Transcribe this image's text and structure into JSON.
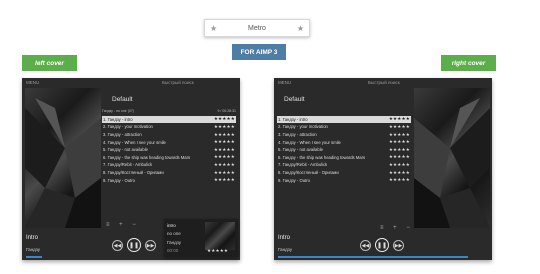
{
  "header": {
    "title": "Metro",
    "left_star": "★",
    "right_star": "★",
    "badge": "FOR AIMP 3"
  },
  "buttons": {
    "left_cover": "left cover",
    "right_cover": "right cover"
  },
  "player": {
    "menu_label": "MENU",
    "search_label": "Быстрый поиск",
    "playlist_name": "Default",
    "playlist_info_left": "Гандзу - no one (07)",
    "playlist_info_right": "9 / 00:28:31",
    "now_playing_title": "Intro",
    "now_playing_artist": "Гандзу",
    "mini_title": "intro",
    "mini_artist": "no one",
    "mini_artist2": "Гандзу",
    "mini_time": "00:00",
    "tools": "≡ + −",
    "stars": "★★★★★",
    "tracks": [
      "1. Гандзу - intro",
      "2. Гандзу - your motivation",
      "3. Гандзу - attraction",
      "4. Гандзу - When I see your smile",
      "5. Гандзу - not available",
      "6. Гандзу - the ship was heading towards Mars",
      "7. Гандзу/Rebit - Ambulick",
      "8. Гандзу/Костленый - Оригами",
      "9. Гандзу - Outro"
    ],
    "controls": {
      "prev": "◀◀",
      "pause": "❚❚",
      "next": "▶▶"
    }
  }
}
